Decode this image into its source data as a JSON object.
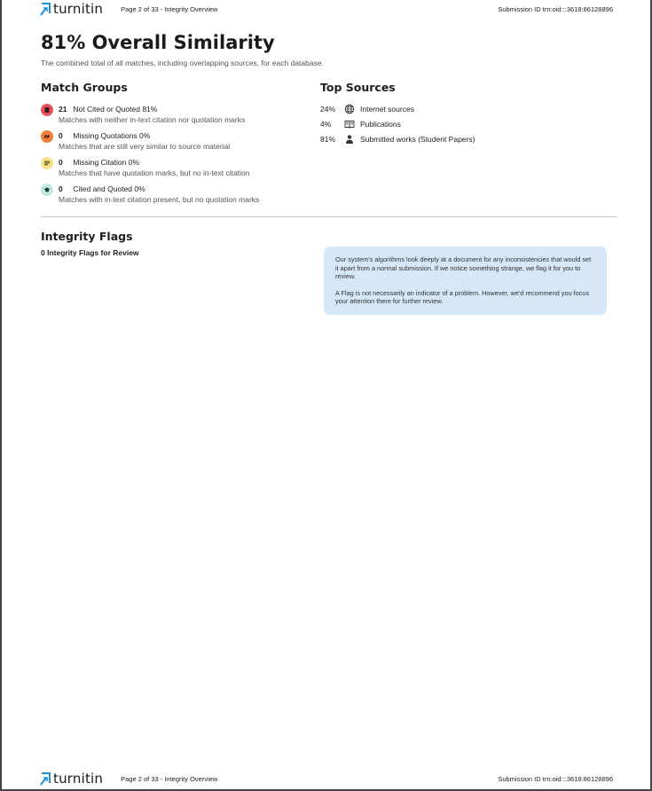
{
  "header": {
    "logo_text": "turnitin",
    "page_label": "Page 2 of 33 - Integrity Overview",
    "submission_id": "Submission ID trn:oid:::3618:86128896"
  },
  "footer": {
    "logo_text": "turnitin",
    "page_label": "Page 2 of 33 - Integrity Overview",
    "submission_id": "Submission ID trn:oid:::3618:86128896"
  },
  "summary": {
    "title": "81% Overall Similarity",
    "subtitle": "The combined total of all matches, including overlapping sources, for each database."
  },
  "match_groups": {
    "heading": "Match Groups",
    "items": [
      {
        "count": "21",
        "label": "Not Cited or Quoted 81%",
        "description": "Matches with neither in-text citation nor quotation marks",
        "color": "#e8505b",
        "icon": "flag-icon"
      },
      {
        "count": "0",
        "label": "Missing Quotations 0%",
        "description": "Matches that are still very similar to source material",
        "color": "#f0803c",
        "icon": "quote-icon"
      },
      {
        "count": "0",
        "label": "Missing Citation 0%",
        "description": "Matches that have quotation marks, but no in-text citation",
        "color": "#f7e28a",
        "icon": "lines-icon"
      },
      {
        "count": "0",
        "label": "Cited and Quoted 0%",
        "description": "Matches with in-text citation present, but no quotation marks",
        "color": "#bfe9de",
        "icon": "graduation-cap-icon"
      }
    ]
  },
  "top_sources": {
    "heading": "Top Sources",
    "items": [
      {
        "percent": "24%",
        "label": "Internet sources",
        "icon": "globe-icon"
      },
      {
        "percent": "4%",
        "label": "Publications",
        "icon": "book-icon"
      },
      {
        "percent": "81%",
        "label": "Submitted works (Student Papers)",
        "icon": "person-icon"
      }
    ]
  },
  "integrity_flags": {
    "heading": "Integrity Flags",
    "count_text": "0 Integrity Flags for Review",
    "info_paragraph_1": "Our system's algorithms look deeply at a document for any inconsistencies that would set it apart from a normal submission. If we notice something strange, we flag it for you to review.",
    "info_paragraph_2": "A Flag is not necessarily an indicator of a problem. However, we'd recommend you focus your attention there for further review."
  }
}
